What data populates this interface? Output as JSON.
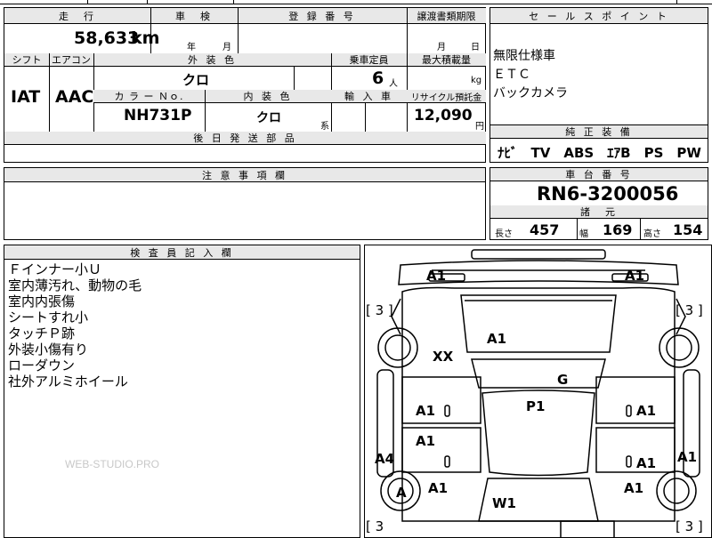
{
  "top_fragments": {
    "left": "",
    "center": "山 陰",
    "right": "ⅲ"
  },
  "main_table": {
    "mileage_label": "走　行",
    "mileage_value": "58,633",
    "mileage_unit": "km",
    "inspection_label": "車　検",
    "year_suffix": "年",
    "month_suffix": "月",
    "reg_number_label": "登 録 番 号",
    "transfer_deadline_label": "譲渡書類期限",
    "transfer_month_suffix": "月",
    "transfer_day_suffix": "日",
    "shift_label": "シフト",
    "aircon_label": "エアコン",
    "exterior_color_label": "外 装 色",
    "capacity_label": "乗車定員",
    "max_load_label": "最大積載量",
    "shift_value": "IAT",
    "aircon_value": "AAC",
    "exterior_color_value": "クロ",
    "capacity_value": "6",
    "capacity_unit": "人",
    "max_load_unit": "kg",
    "color_no_label": "カ ラ ー Ｎｏ.",
    "interior_color_label": "内 装 色",
    "import_label": "輸 入 車",
    "recycle_label": "リサイクル預託金",
    "color_no_value": "NH731P",
    "interior_color_value": "クロ",
    "interior_color_suffix": "系",
    "recycle_value": "12,090",
    "recycle_unit": "円",
    "later_parts_label": "後 日 発 送 部 品"
  },
  "sales_points": {
    "label": "セ ー ル ス ポ イ ン ト",
    "lines": [
      "無限仕様車",
      "ＥＴＣ",
      "バックカメラ"
    ]
  },
  "genuine_equipment": {
    "label": "純 正 装 備",
    "value": "ﾅﾋﾞ　TV　ABS　ｴｱB　PS　PW"
  },
  "caution": {
    "label": "注 意 事 項 欄"
  },
  "chassis": {
    "label": "車 台 番 号",
    "value": "RN6-3200056",
    "specs_label": "諸　元",
    "length_label": "長さ",
    "length_value": "457",
    "width_label": "幅",
    "width_value": "169",
    "height_label": "高さ",
    "height_value": "154"
  },
  "inspector_notes": {
    "label": "検 査 員 記 入 欄",
    "lines": [
      "Ｆインナー小Ｕ",
      "室内薄汚れ、動物の毛",
      "室内内張傷",
      "シートすれ小",
      "タッチＰ跡",
      "外装小傷有り",
      "ローダウン",
      "社外アルミホイール"
    ],
    "watermark": "WEB-STUDIO.PRO"
  },
  "diagram": {
    "marks": {
      "front_left": "A1",
      "front_right": "A1",
      "bracket_fl": "[ 3 ]",
      "bracket_fr": "[ 3 ]",
      "bracket_rl": "[ 3",
      "bracket_rr": "[ 3 ]",
      "hood": "A1",
      "front_fender_left": "XX",
      "windshield": "G",
      "roof": "P1",
      "front_door_left": "A1",
      "front_door_right": "A1",
      "rear_door_left": "A1",
      "rear_door_right": "A1",
      "sill_left": "A4",
      "sill_right": "A1",
      "rear_wheel_left": "A",
      "rear_fender_left": "A1",
      "rear_fender_right": "A1",
      "rear_window": "W1",
      "circle_small": "O"
    }
  }
}
